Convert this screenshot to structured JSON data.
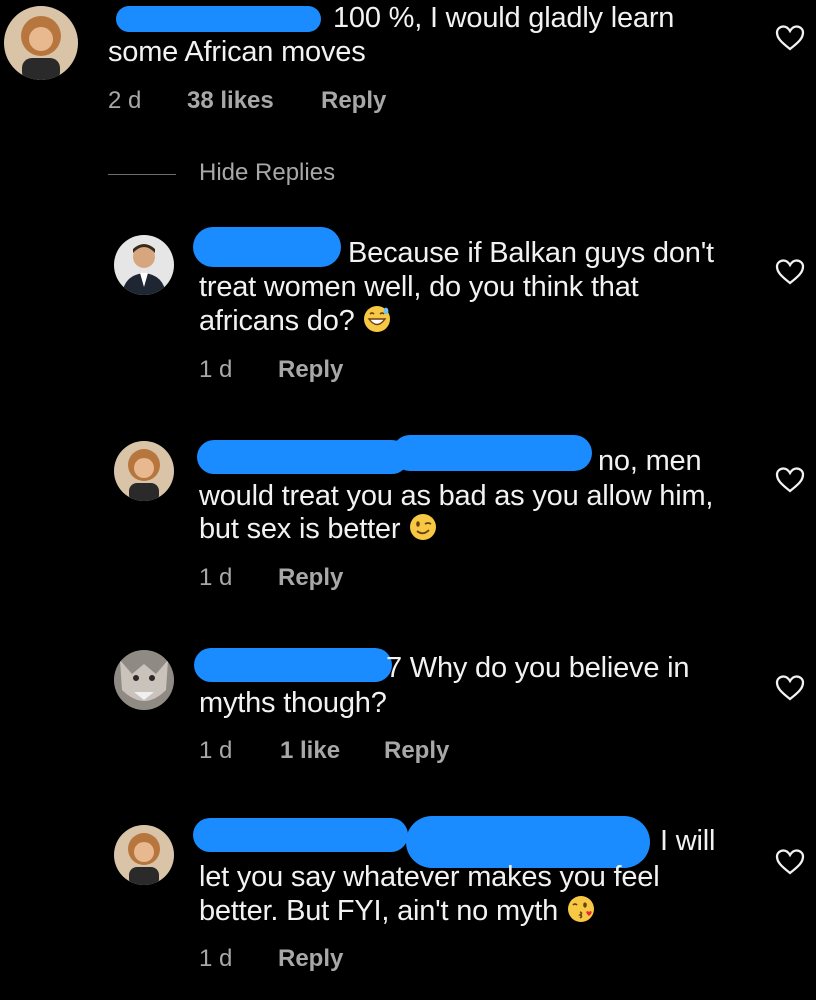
{
  "comments": [
    {
      "text_line1": "100 %, I would gladly learn",
      "text_line2": "some African moves",
      "time": "2 d",
      "likes": "38 likes",
      "reply": "Reply"
    }
  ],
  "hide_replies": "Hide Replies",
  "replies": [
    {
      "line1": "Because if Balkan guys don't",
      "line2": "treat women well, do you think that",
      "line3": "africans do?",
      "emoji": "grinning-sweat-emoji",
      "time": "1 d",
      "reply": "Reply"
    },
    {
      "line1": "no, men",
      "line2": "would treat you as bad as you allow him,",
      "line3": "but sex is better",
      "emoji": "winking-face-emoji",
      "time": "1 d",
      "reply": "Reply"
    },
    {
      "line1": "7 Why do you believe in",
      "line2": "myths though?",
      "time": "1 d",
      "likes": "1 like",
      "reply": "Reply"
    },
    {
      "line1": "I will",
      "line2": "let you say whatever makes you feel",
      "line3": "better. But FYI, ain't no myth",
      "emoji": "face-blowing-kiss-emoji",
      "time": "1 d",
      "reply": "Reply"
    }
  ],
  "icons": {
    "heart": "heart-outline-icon"
  },
  "colors": {
    "background": "#000000",
    "text": "#f2f2f2",
    "meta": "#a8a8a8",
    "redaction": "#1a8cff"
  }
}
